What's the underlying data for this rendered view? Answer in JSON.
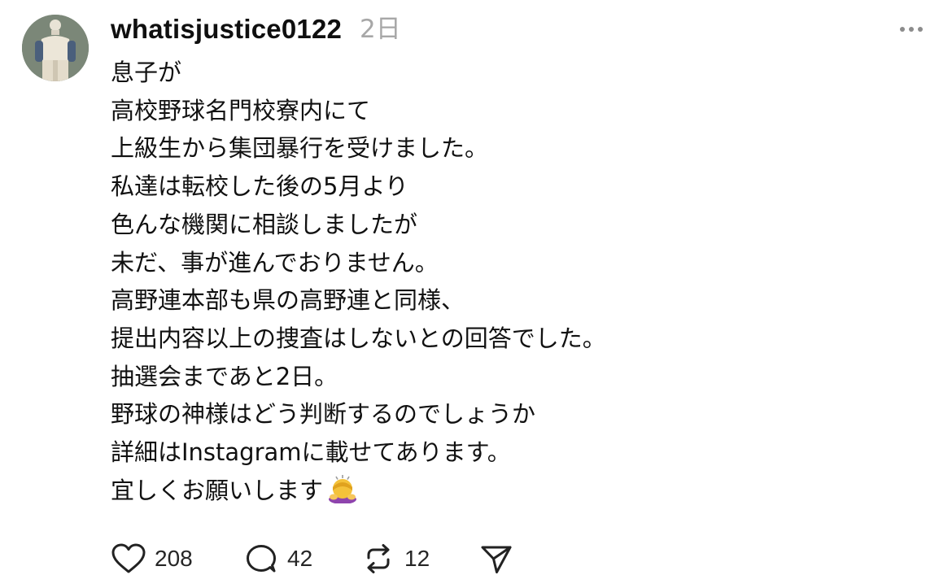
{
  "post": {
    "username": "whatisjustice0122",
    "timestamp": "2日",
    "lines": [
      "息子が",
      "高校野球名門校寮内にて",
      "上級生から集団暴行を受けました。",
      "私達は転校した後の5月より",
      "色んな機関に相談しましたが",
      "未だ、事が進んでおりません。",
      "高野連本部も県の高野連と同様、",
      "提出内容以上の捜査はしないとの回答でした。",
      "抽選会まであと2日。",
      "野球の神様はどう判断するのでしょうか",
      "詳細はInstagramに載せてあります。",
      "宜しくお願いします"
    ],
    "last_line_emoji": "person-bowing-emoji"
  },
  "actions": {
    "like_count": "208",
    "comment_count": "42",
    "repost_count": "12"
  },
  "icons": {
    "avatar": "baseball-player-avatar",
    "more": "more-dots-icon",
    "like": "heart-icon",
    "comment": "comment-bubble-icon",
    "repost": "repost-icon",
    "share": "share-send-icon"
  }
}
